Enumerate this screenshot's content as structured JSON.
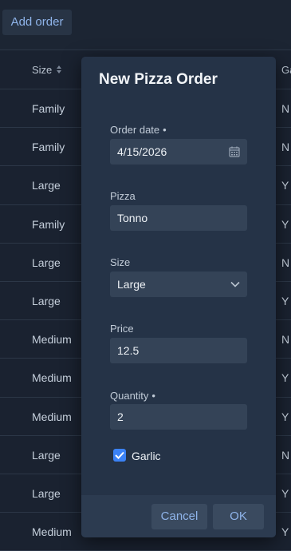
{
  "toolbar": {
    "add_order_label": "Add order"
  },
  "table": {
    "columns": {
      "size": "Size",
      "garlic": "Ga"
    },
    "rows": [
      {
        "size": "Family",
        "garlic": "N"
      },
      {
        "size": "Family",
        "garlic": "N"
      },
      {
        "size": "Large",
        "garlic": "Y"
      },
      {
        "size": "Family",
        "garlic": "Y"
      },
      {
        "size": "Large",
        "garlic": "N"
      },
      {
        "size": "Large",
        "garlic": "Y"
      },
      {
        "size": "Medium",
        "garlic": "N"
      },
      {
        "size": "Medium",
        "garlic": "Y"
      },
      {
        "size": "Medium",
        "garlic": "Y"
      },
      {
        "size": "Large",
        "garlic": "N"
      },
      {
        "size": "Large",
        "garlic": "Y"
      },
      {
        "size": "Medium",
        "garlic": "Y"
      }
    ]
  },
  "dialog": {
    "title": "New Pizza Order",
    "order_date": {
      "label": "Order date",
      "required_mark": "•",
      "value": "4/15/2026"
    },
    "pizza": {
      "label": "Pizza",
      "value": "Tonno"
    },
    "size": {
      "label": "Size",
      "value": "Large"
    },
    "price": {
      "label": "Price",
      "value": "12.5"
    },
    "quantity": {
      "label": "Quantity",
      "required_mark": "•",
      "value": "2"
    },
    "garlic": {
      "label": "Garlic",
      "checked": true
    },
    "cancel_label": "Cancel",
    "ok_label": "OK"
  },
  "icons": {
    "calendar": "calendar-icon",
    "chevron": "chevron-down-icon",
    "sort": "sort-icon",
    "check": "check-icon"
  },
  "colors": {
    "accent": "#3b82f6",
    "link": "#8fb4ea",
    "dialog_bg": "#253347",
    "page_bg": "#1a2230"
  }
}
